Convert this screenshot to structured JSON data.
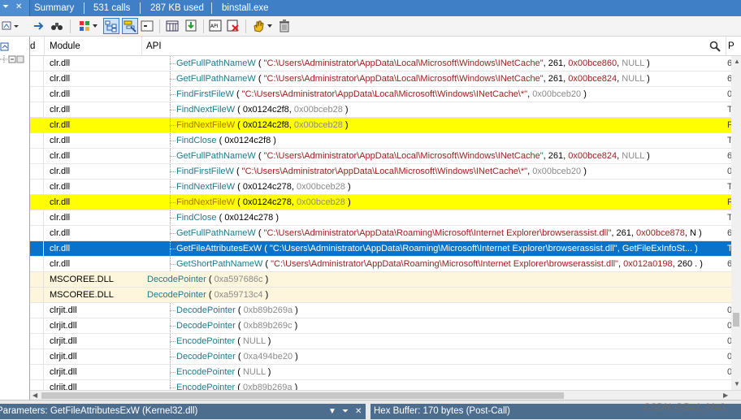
{
  "topbar": {
    "summary": "Summary",
    "calls": "531 calls",
    "used": "287 KB used",
    "process": "binstall.exe"
  },
  "columns": {
    "id": "d",
    "module": "Module",
    "api": "API",
    "search_icon": "search-icon"
  },
  "rows": [
    {
      "module": "clr.dll",
      "fn": "GetFullPathNameW",
      "args": [
        {
          "t": "str",
          "v": "\"C:\\Users\\Administrator\\AppData\\Local\\Microsoft\\Windows\\INetCache\""
        },
        {
          "t": "plain",
          "v": ", 261, "
        },
        {
          "t": "str",
          "v": "0x00bce860"
        },
        {
          "t": "plain",
          "v": ", "
        },
        {
          "t": "num",
          "v": "NULL"
        }
      ],
      "last": "6",
      "style": ""
    },
    {
      "module": "clr.dll",
      "fn": "GetFullPathNameW",
      "args": [
        {
          "t": "str",
          "v": "\"C:\\Users\\Administrator\\AppData\\Local\\Microsoft\\Windows\\INetCache\""
        },
        {
          "t": "plain",
          "v": ", 261, "
        },
        {
          "t": "str",
          "v": "0x00bce824"
        },
        {
          "t": "plain",
          "v": ", "
        },
        {
          "t": "num",
          "v": "NULL"
        }
      ],
      "last": "6",
      "style": ""
    },
    {
      "module": "clr.dll",
      "fn": "FindFirstFileW",
      "args": [
        {
          "t": "str",
          "v": "\"C:\\Users\\Administrator\\AppData\\Local\\Microsoft\\Windows\\INetCache\\*\""
        },
        {
          "t": "plain",
          "v": ", "
        },
        {
          "t": "num",
          "v": "0x00bceb20"
        }
      ],
      "last": "0",
      "style": ""
    },
    {
      "module": "clr.dll",
      "fn": "FindNextFileW",
      "args": [
        {
          "t": "plain",
          "v": "0x0124c2f8, "
        },
        {
          "t": "num",
          "v": "0x00bceb28"
        }
      ],
      "last": "T",
      "style": ""
    },
    {
      "module": "clr.dll",
      "fn": "FindNextFileW",
      "args": [
        {
          "t": "plain",
          "v": "0x0124c2f8, "
        },
        {
          "t": "num",
          "v": "0x00bceb28"
        }
      ],
      "last": "F",
      "style": "hl-yellow"
    },
    {
      "module": "clr.dll",
      "fn": "FindClose",
      "args": [
        {
          "t": "plain",
          "v": "0x0124c2f8"
        }
      ],
      "last": "T",
      "style": ""
    },
    {
      "module": "clr.dll",
      "fn": "GetFullPathNameW",
      "args": [
        {
          "t": "str",
          "v": "\"C:\\Users\\Administrator\\AppData\\Local\\Microsoft\\Windows\\INetCache\""
        },
        {
          "t": "plain",
          "v": ", 261, "
        },
        {
          "t": "str",
          "v": "0x00bce824"
        },
        {
          "t": "plain",
          "v": ", "
        },
        {
          "t": "num",
          "v": "NULL"
        }
      ],
      "last": "6",
      "style": ""
    },
    {
      "module": "clr.dll",
      "fn": "FindFirstFileW",
      "args": [
        {
          "t": "str",
          "v": "\"C:\\Users\\Administrator\\AppData\\Local\\Microsoft\\Windows\\INetCache\\*\""
        },
        {
          "t": "plain",
          "v": ", "
        },
        {
          "t": "num",
          "v": "0x00bceb20"
        }
      ],
      "last": "0",
      "style": ""
    },
    {
      "module": "clr.dll",
      "fn": "FindNextFileW",
      "args": [
        {
          "t": "plain",
          "v": "0x0124c278, "
        },
        {
          "t": "num",
          "v": "0x00bceb28"
        }
      ],
      "last": "T",
      "style": ""
    },
    {
      "module": "clr.dll",
      "fn": "FindNextFileW",
      "args": [
        {
          "t": "plain",
          "v": "0x0124c278, "
        },
        {
          "t": "num",
          "v": "0x00bceb28"
        }
      ],
      "last": "F",
      "style": "hl-yellow"
    },
    {
      "module": "clr.dll",
      "fn": "FindClose",
      "args": [
        {
          "t": "plain",
          "v": "0x0124c278"
        }
      ],
      "last": "T",
      "style": ""
    },
    {
      "module": "clr.dll",
      "fn": "GetFullPathNameW",
      "args": [
        {
          "t": "str",
          "v": "\"C:\\Users\\Administrator\\AppData\\Roaming\\Microsoft\\Internet Explorer\\browserassist.dll\""
        },
        {
          "t": "plain",
          "v": ", 261, "
        },
        {
          "t": "str",
          "v": "0x00bce878"
        },
        {
          "t": "plain",
          "v": ", N"
        }
      ],
      "last": "6",
      "style": ""
    },
    {
      "module": "clr.dll",
      "fn": "GetFileAttributesExW",
      "args": [
        {
          "t": "str",
          "v": "\"C:\\Users\\Administrator\\AppData\\Roaming\\Microsoft\\Internet Explorer\\browserassist.dll\""
        },
        {
          "t": "plain",
          "v": ", GetFileExInfoSt..."
        }
      ],
      "last": "T",
      "style": "hl-sel"
    },
    {
      "module": "clr.dll",
      "fn": "GetShortPathNameW",
      "args": [
        {
          "t": "str",
          "v": "\"C:\\Users\\Administrator\\AppData\\Roaming\\Microsoft\\Internet Explorer\\browserassist.dll\""
        },
        {
          "t": "plain",
          "v": ", "
        },
        {
          "t": "str",
          "v": "0x012a0198"
        },
        {
          "t": "plain",
          "v": ", 260 ."
        }
      ],
      "last": "6",
      "style": ""
    },
    {
      "module": "MSCOREE.DLL",
      "fn": "DecodePointer",
      "args": [
        {
          "t": "num",
          "v": "0xa597686c"
        }
      ],
      "last": "",
      "style": "hl-cream",
      "level": 0
    },
    {
      "module": "MSCOREE.DLL",
      "fn": "DecodePointer",
      "args": [
        {
          "t": "num",
          "v": "0xa59713c4"
        }
      ],
      "last": "",
      "style": "hl-cream",
      "level": 0
    },
    {
      "module": "clrjit.dll",
      "fn": "DecodePointer",
      "args": [
        {
          "t": "num",
          "v": "0xb89b269a"
        }
      ],
      "last": "0",
      "style": ""
    },
    {
      "module": "clrjit.dll",
      "fn": "DecodePointer",
      "args": [
        {
          "t": "num",
          "v": "0xb89b269c"
        }
      ],
      "last": "0",
      "style": ""
    },
    {
      "module": "clrjit.dll",
      "fn": "EncodePointer",
      "args": [
        {
          "t": "num",
          "v": "NULL"
        }
      ],
      "last": "0",
      "style": ""
    },
    {
      "module": "clrjit.dll",
      "fn": "DecodePointer",
      "args": [
        {
          "t": "num",
          "v": "0xa494be20"
        }
      ],
      "last": "0",
      "style": ""
    },
    {
      "module": "clrjit.dll",
      "fn": "EncodePointer",
      "args": [
        {
          "t": "num",
          "v": "NULL"
        }
      ],
      "last": "0",
      "style": ""
    },
    {
      "module": "clrjit.dll",
      "fn": "EncodePointer",
      "args": [
        {
          "t": "num",
          "v": "0xb89b269a"
        }
      ],
      "last": "",
      "style": ""
    }
  ],
  "bottom": {
    "params_title": "Parameters: GetFileAttributesExW (Kernel32.dll)",
    "hex_title": "Hex Buffer: 170 bytes (Post-Call)",
    "watermark": "CSDN @Ba1_Ma0"
  },
  "colors": {
    "tab_blue": "#3f7fc5",
    "selected_row": "#0a73c9",
    "highlight_yellow": "#ffff00",
    "module_cream": "#fdf6dc",
    "function_teal": "#1c7a8c",
    "string_red": "#9b1c1c"
  }
}
